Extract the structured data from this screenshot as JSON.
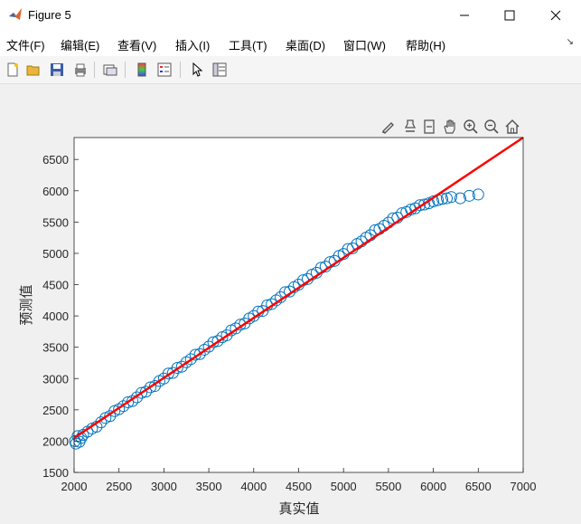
{
  "window": {
    "title": "Figure 5"
  },
  "menu": [
    {
      "label": "文件(F)"
    },
    {
      "label": "编辑(E)"
    },
    {
      "label": "查看(V)"
    },
    {
      "label": "插入(I)"
    },
    {
      "label": "工具(T)"
    },
    {
      "label": "桌面(D)"
    },
    {
      "label": "窗口(W)"
    },
    {
      "label": "帮助(H)"
    }
  ],
  "toolbar": [
    "new-figure-icon",
    "open-folder-icon",
    "save-icon",
    "print-icon",
    "link-plot-icon",
    "colorbar-icon",
    "legend-icon",
    "pointer-icon",
    "property-inspector-icon"
  ],
  "axes_toolbar": [
    "brush-icon",
    "data-cursor-icon",
    "pan-hand-icon",
    "zoom-in-icon",
    "zoom-out-icon",
    "home-icon"
  ],
  "colors": {
    "scatter": "#0072BD",
    "fit_line": "#FF0000"
  },
  "chart_data": {
    "type": "scatter",
    "xlabel": "真实值",
    "ylabel": "预测值",
    "xlim": [
      2000,
      7000
    ],
    "ylim": [
      1500,
      6850
    ],
    "xticks": [
      "2000",
      "2500",
      "3000",
      "3500",
      "4000",
      "4500",
      "5000",
      "5500",
      "6000",
      "6500",
      "7000"
    ],
    "yticks": [
      "1500",
      "2000",
      "2500",
      "3000",
      "3500",
      "4000",
      "4500",
      "5000",
      "5500",
      "6000",
      "6500"
    ],
    "marker": "open-circle",
    "series": [
      {
        "x": [
          2010,
          2020,
          2040,
          2060,
          2080,
          2100,
          2150,
          2200,
          2250,
          2300,
          2350,
          2400,
          2450,
          2500,
          2550,
          2600,
          2650,
          2700,
          2750,
          2800,
          2850,
          2900,
          2950,
          3000,
          3050,
          3100,
          3150,
          3200,
          3250,
          3300,
          3350,
          3400,
          3450,
          3500,
          3550,
          3600,
          3650,
          3700,
          3750,
          3800,
          3850,
          3900,
          3950,
          4000,
          4050,
          4100,
          4150,
          4200,
          4250,
          4300,
          4350,
          4400,
          4450,
          4500,
          4550,
          4600,
          4650,
          4700,
          4750,
          4800,
          4850,
          4900,
          4950,
          5000,
          5050,
          5100,
          5150,
          5200,
          5250,
          5300,
          5350,
          5400,
          5450,
          5500,
          5550,
          5600,
          5650,
          5700,
          5750,
          5800,
          5850,
          5900,
          5950,
          6000,
          6050,
          6100,
          6150,
          6200,
          6300,
          6400,
          6500
        ],
        "y": [
          2000,
          1960,
          2080,
          1990,
          2050,
          2100,
          2150,
          2200,
          2230,
          2300,
          2370,
          2400,
          2480,
          2510,
          2560,
          2620,
          2640,
          2700,
          2770,
          2790,
          2860,
          2880,
          2960,
          3000,
          3080,
          3090,
          3170,
          3190,
          3260,
          3310,
          3380,
          3390,
          3460,
          3510,
          3580,
          3600,
          3660,
          3690,
          3770,
          3800,
          3860,
          3880,
          3960,
          4000,
          4070,
          4080,
          4170,
          4190,
          4250,
          4300,
          4380,
          4390,
          4460,
          4500,
          4570,
          4590,
          4660,
          4690,
          4770,
          4790,
          4860,
          4880,
          4960,
          4990,
          5070,
          5080,
          5150,
          5190,
          5250,
          5290,
          5370,
          5390,
          5440,
          5490,
          5560,
          5570,
          5640,
          5660,
          5700,
          5720,
          5770,
          5780,
          5800,
          5830,
          5850,
          5870,
          5880,
          5900,
          5880,
          5920,
          5940
        ]
      }
    ],
    "fit_line": {
      "x": [
        2000,
        7000
      ],
      "y": [
        2050,
        6850
      ]
    }
  }
}
